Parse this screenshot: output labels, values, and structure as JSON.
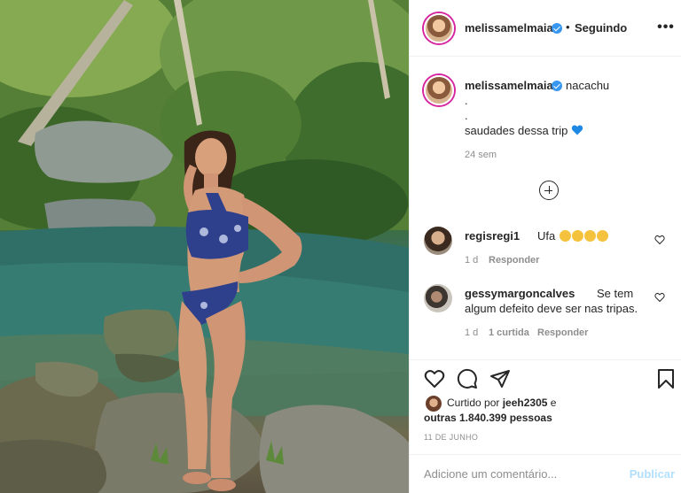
{
  "header": {
    "username": "melissamelmaia",
    "separator": "•",
    "follow_label": "Seguindo",
    "more_label": "•••"
  },
  "caption": {
    "username": "melissamelmaia",
    "line1": "nacachu",
    "line2": ".",
    "line3": ".",
    "line4": "saudades dessa trip",
    "heart_color": "#3897f0",
    "age": "24 sem"
  },
  "comments": [
    {
      "username": "regisregi1",
      "text": "Ufa",
      "emojis": [
        "heart-eyes-emoji",
        "heart-eyes-emoji",
        "kissing-heart-emoji",
        "kissing-heart-emoji"
      ],
      "age": "1 d",
      "reply_label": "Responder"
    },
    {
      "username": "gessymargoncalves",
      "text_line1": "Se tem",
      "text_line2": "algum defeito deve ser nas tripas.",
      "age": "1 d",
      "likes": "1 curtida",
      "reply_label": "Responder"
    }
  ],
  "likes": {
    "prefix": "Curtido por ",
    "user": "jeeh2305",
    "mid": " e",
    "others": "outras 1.840.399 pessoas"
  },
  "date": "11 DE JUNHO",
  "comment_box": {
    "placeholder": "Adicione um comentário...",
    "publish_label": "Publicar"
  },
  "colors": {
    "verified": "#3897f0",
    "story_ring": "#d6249f",
    "publish_disabled": "#b2dffc"
  }
}
